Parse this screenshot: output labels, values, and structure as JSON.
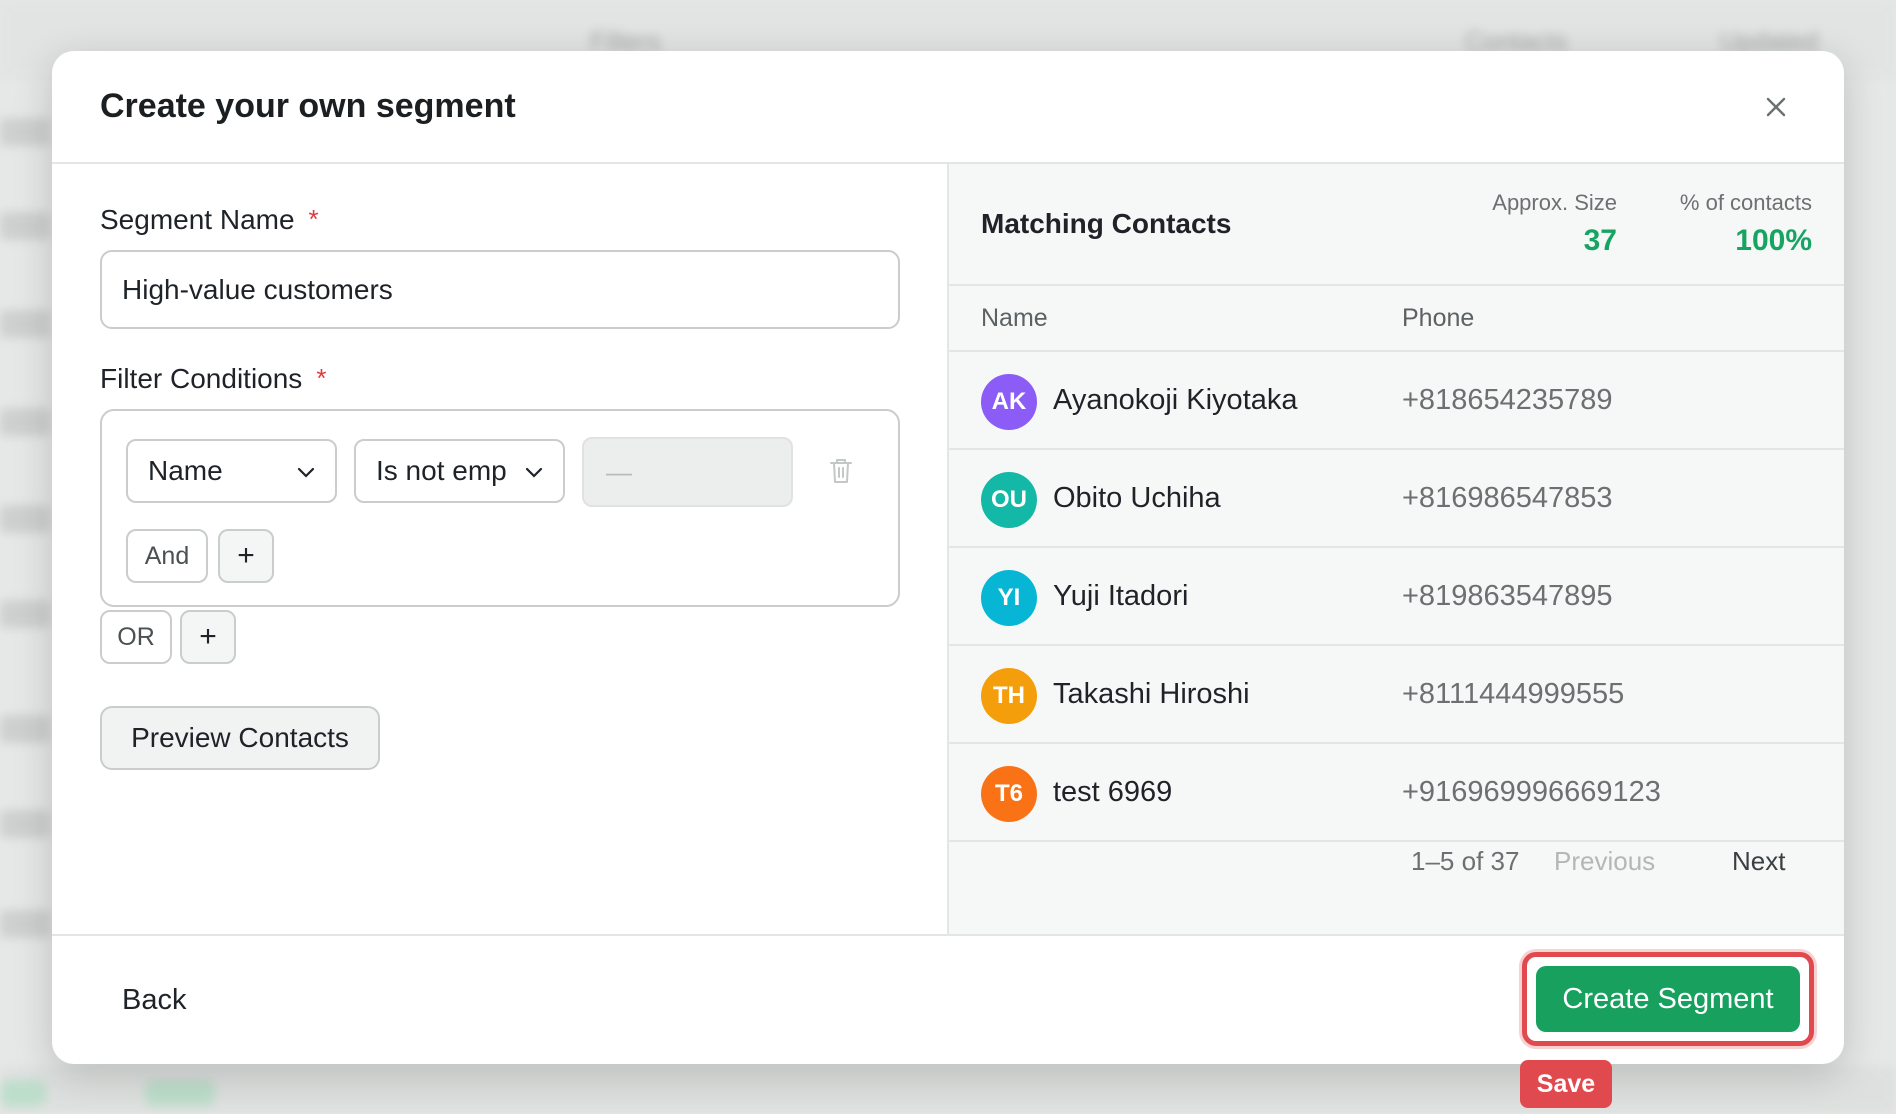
{
  "background": {
    "headers": [
      "Filters",
      "Contacts",
      "Updated"
    ]
  },
  "modal": {
    "title": "Create your own segment",
    "close_icon": "close-icon"
  },
  "form": {
    "segment_name_label": "Segment Name",
    "required_mark": "*",
    "segment_name_value": "High-value customers",
    "filter_conditions_label": "Filter Conditions",
    "condition": {
      "field": "Name",
      "operator": "Is not emp",
      "value": "—"
    },
    "and_label": "And",
    "or_label": "OR",
    "plus_label": "+",
    "preview_label": "Preview Contacts"
  },
  "matching": {
    "title": "Matching Contacts",
    "approx_size_label": "Approx. Size",
    "approx_size_value": "37",
    "percent_label": "% of contacts",
    "percent_value": "100%",
    "columns": {
      "name": "Name",
      "phone": "Phone"
    },
    "contacts": [
      {
        "initials": "AK",
        "name": "Ayanokoji Kiyotaka",
        "phone": "+818654235789",
        "color": "#8b5cf6"
      },
      {
        "initials": "OU",
        "name": "Obito Uchiha",
        "phone": "+816986547853",
        "color": "#14b8a6"
      },
      {
        "initials": "YI",
        "name": "Yuji Itadori",
        "phone": "+819863547895",
        "color": "#06b6d4"
      },
      {
        "initials": "TH",
        "name": "Takashi Hiroshi",
        "phone": "+8111444999555",
        "color": "#f59e0b"
      },
      {
        "initials": "T6",
        "name": "test 6969",
        "phone": "+916969996669123",
        "color": "#f97316"
      }
    ],
    "pager": {
      "range": "1–5 of 37",
      "previous": "Previous",
      "next": "Next"
    }
  },
  "footer": {
    "back_label": "Back",
    "create_label": "Create Segment",
    "save_tag": "Save"
  },
  "colors": {
    "accent": "#18a05f",
    "highlight": "#e04a4f"
  }
}
